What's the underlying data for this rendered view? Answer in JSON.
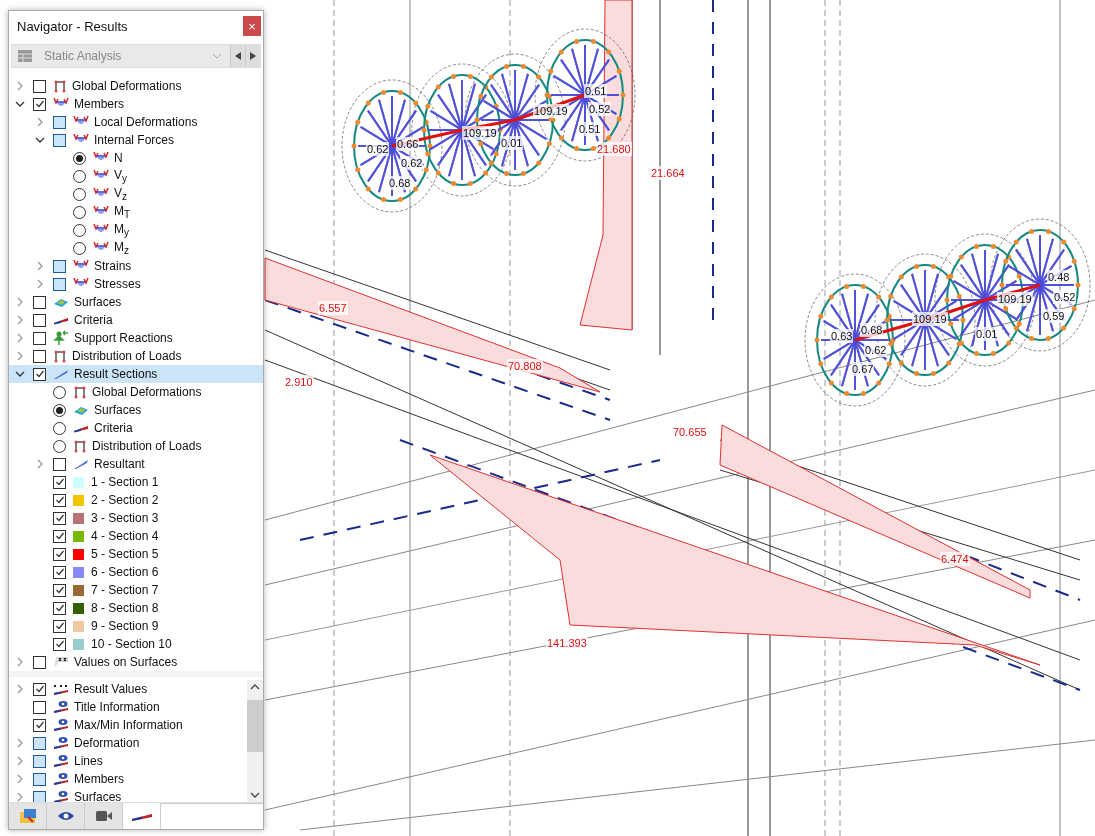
{
  "navigator": {
    "title": "Navigator - Results",
    "close": "×",
    "load_case": {
      "value": "Static Analysis",
      "disabled": true
    },
    "tree": [
      {
        "label": "Global Deformations",
        "kind": "check",
        "checked": false,
        "expanded": false,
        "selected": false
      },
      {
        "label": "Members",
        "kind": "check",
        "checked": true,
        "expanded": true,
        "selected": false,
        "children": [
          {
            "label": "Local Deformations",
            "kind": "check",
            "checked": false,
            "mixed": true,
            "expanded": false,
            "selected": false
          },
          {
            "label": "Internal Forces",
            "kind": "check",
            "checked": false,
            "mixed": true,
            "expanded": true,
            "selected": false,
            "children": [
              {
                "label": "N",
                "kind": "radio",
                "checked": true,
                "selected": false
              },
              {
                "label": "V$_{y}$",
                "kind": "radio",
                "checked": false,
                "selected": false
              },
              {
                "label": "V$_{z}$",
                "kind": "radio",
                "checked": false,
                "selected": false
              },
              {
                "label": "M$_{T}$",
                "kind": "radio",
                "checked": false,
                "selected": false
              },
              {
                "label": "M$_{y}$",
                "kind": "radio",
                "checked": false,
                "selected": false
              },
              {
                "label": "M$_{z}$",
                "kind": "radio",
                "checked": false,
                "selected": false
              }
            ]
          },
          {
            "label": "Strains",
            "kind": "check",
            "checked": false,
            "mixed": true,
            "expanded": false,
            "selected": false
          },
          {
            "label": "Stresses",
            "kind": "check",
            "checked": false,
            "mixed": true,
            "expanded": false,
            "selected": false
          }
        ]
      },
      {
        "label": "Surfaces",
        "kind": "check",
        "checked": false,
        "expanded": false,
        "selected": false
      },
      {
        "label": "Criteria",
        "kind": "check",
        "checked": false,
        "expanded": false,
        "selected": false
      },
      {
        "label": "Support Reactions",
        "kind": "check",
        "checked": false,
        "expanded": false,
        "selected": false
      },
      {
        "label": "Distribution of Loads",
        "kind": "check",
        "checked": false,
        "expanded": false,
        "selected": false
      },
      {
        "label": "Result Sections",
        "kind": "check",
        "checked": true,
        "expanded": true,
        "selected": true,
        "children": [
          {
            "label": "Global Deformations",
            "kind": "radio",
            "checked": false,
            "selected": false
          },
          {
            "label": "Surfaces",
            "kind": "radio",
            "checked": true,
            "selected": false
          },
          {
            "label": "Criteria",
            "kind": "radio",
            "checked": false,
            "selected": false
          },
          {
            "label": "Distribution of Loads",
            "kind": "radio",
            "checked": false,
            "selected": false
          },
          {
            "label": "Resultant",
            "kind": "check",
            "checked": false,
            "expanded": false,
            "selected": false
          },
          {
            "label": "1 - Section 1",
            "kind": "section",
            "checked": true,
            "color": "#ccffff",
            "selected": false
          },
          {
            "label": "2 - Section 2",
            "kind": "section",
            "checked": true,
            "color": "#f5c400",
            "selected": false
          },
          {
            "label": "3 - Section 3",
            "kind": "section",
            "checked": true,
            "color": "#b87272",
            "selected": false
          },
          {
            "label": "4 - Section 4",
            "kind": "section",
            "checked": true,
            "color": "#7ab800",
            "selected": false
          },
          {
            "label": "5 - Section 5",
            "kind": "section",
            "checked": true,
            "color": "#ff0000",
            "selected": false
          },
          {
            "label": "6 - Section 6",
            "kind": "section",
            "checked": true,
            "color": "#8888ff",
            "selected": false
          },
          {
            "label": "7 - Section 7",
            "kind": "section",
            "checked": true,
            "color": "#966a30",
            "selected": false
          },
          {
            "label": "8 - Section 8",
            "kind": "section",
            "checked": true,
            "color": "#335f00",
            "selected": false
          },
          {
            "label": "9 - Section 9",
            "kind": "section",
            "checked": true,
            "color": "#f0c8a0",
            "selected": false
          },
          {
            "label": "10 - Section 10",
            "kind": "section",
            "checked": true,
            "color": "#99cccc",
            "selected": false
          }
        ]
      },
      {
        "label": "Values on Surfaces",
        "kind": "check",
        "checked": false,
        "expanded": false,
        "selected": false
      }
    ],
    "display": [
      {
        "label": "Result Values",
        "kind": "check",
        "checked": true,
        "expanded": false,
        "selected": false
      },
      {
        "label": "Title Information",
        "kind": "check",
        "checked": false,
        "selected": false
      },
      {
        "label": "Max/Min Information",
        "kind": "check",
        "checked": true,
        "selected": false
      },
      {
        "label": "Deformation",
        "kind": "check",
        "checked": false,
        "mixed": true,
        "expanded": false,
        "selected": false
      },
      {
        "label": "Lines",
        "kind": "check",
        "checked": false,
        "mixed": true,
        "expanded": false,
        "selected": false
      },
      {
        "label": "Members",
        "kind": "check",
        "checked": false,
        "mixed": true,
        "expanded": false,
        "selected": false
      },
      {
        "label": "Surfaces",
        "kind": "check",
        "checked": false,
        "mixed": true,
        "expanded": false,
        "selected": false
      }
    ],
    "tabs": [
      {
        "selected": false
      },
      {
        "selected": false
      },
      {
        "selected": false
      },
      {
        "selected": true
      }
    ]
  },
  "viewport": {
    "diagram_values": [
      "21.680",
      "21.664",
      "6.557",
      "70.808",
      "2.910",
      "70.655",
      "6.474",
      "141.393"
    ],
    "ratio_values": [
      "0.62",
      "0.66",
      "0.62",
      "0.68",
      "109.19",
      "0.01",
      "109.19",
      "0.61",
      "0.52",
      "0.51",
      "0.63",
      "0.68",
      "0.62",
      "0.67",
      "109.19",
      "0.01",
      "109.19",
      "0.48",
      "0.52",
      "0.59"
    ]
  }
}
